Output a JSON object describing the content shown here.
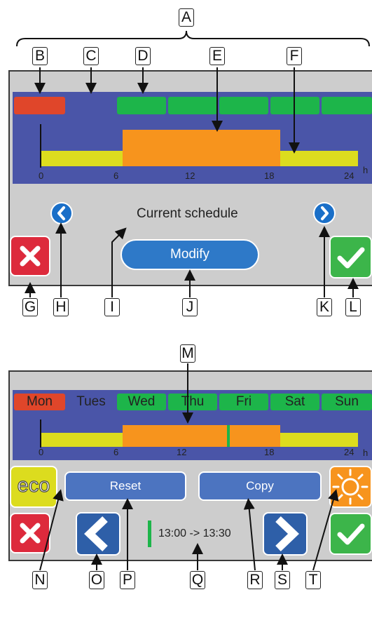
{
  "callouts": {
    "a": "A",
    "b": "B",
    "c": "C",
    "d": "D",
    "e": "E",
    "f": "F",
    "g": "G",
    "h": "H",
    "i": "I",
    "j": "J",
    "k": "K",
    "l": "L",
    "m": "M",
    "n": "N",
    "o": "O",
    "p": "P",
    "q": "Q",
    "r": "R",
    "s": "S",
    "t": "T"
  },
  "top_panel": {
    "ticks": [
      "0",
      "6",
      "12",
      "18",
      "24"
    ],
    "hours_unit": "h",
    "status_text": "Current schedule",
    "modify_label": "Modify"
  },
  "bottom_panel": {
    "days": [
      "Mon",
      "Tues",
      "Wed",
      "Thu",
      "Fri",
      "Sat",
      "Sun"
    ],
    "ticks": [
      "0",
      "6",
      "12",
      "18",
      "24"
    ],
    "hours_unit": "h",
    "eco_label": "eco",
    "reset_label": "Reset",
    "copy_label": "Copy",
    "time_range": "13:00 -> 13:30"
  },
  "schedule": {
    "comfort_start_h": 5,
    "comfort_end_h": 18,
    "cursor_h": 13
  },
  "colors": {
    "panel_bg": "#cdcdcd",
    "schedule_bg": "#4a55a8",
    "selected_day": "#e0462a",
    "day_green": "#1db54a",
    "eco_yellow": "#dcdc1e",
    "comfort_orange": "#f7941d",
    "cancel_red": "#dd2a3c",
    "ok_green": "#3cb54a",
    "accent_blue": "#2e79c8"
  }
}
